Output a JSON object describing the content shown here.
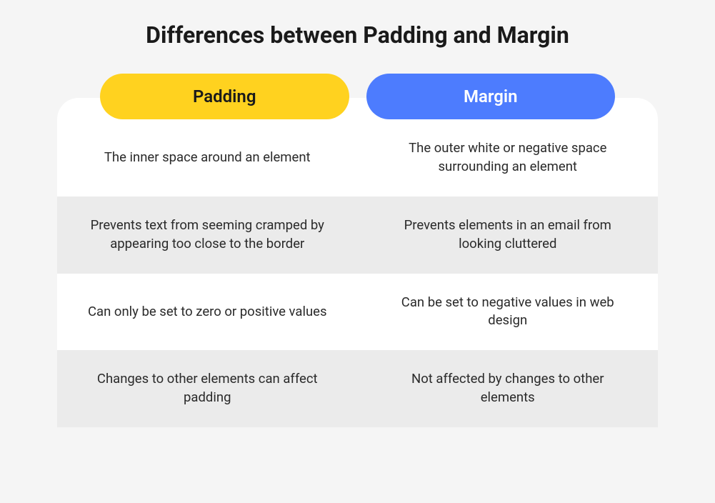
{
  "title": "Differences between Padding and Margin",
  "columns": {
    "left": "Padding",
    "right": "Margin"
  },
  "rows": [
    {
      "left": "The inner space around an element",
      "right": "The outer white or negative space surrounding an element"
    },
    {
      "left": "Prevents text from seeming cramped by appearing too close to the border",
      "right": "Prevents elements in an email from looking cluttered"
    },
    {
      "left": "Can only be set to zero or positive values",
      "right": "Can be set to negative values in web design"
    },
    {
      "left": "Changes to other elements can affect padding",
      "right": "Not affected by changes to other elements"
    }
  ]
}
